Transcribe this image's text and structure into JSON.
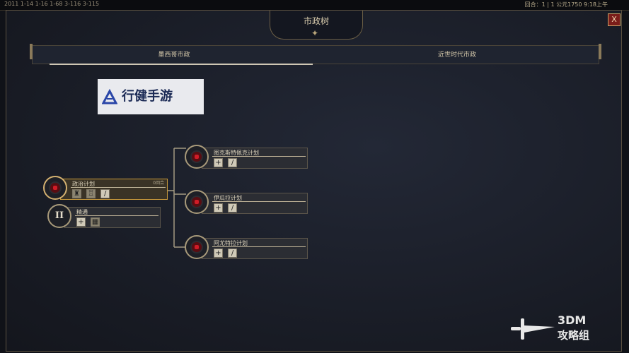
{
  "topbar": {
    "left_text": "2011 1-14 1-16 1-68 3-116 3-115",
    "right_text": "回合：1 | 1  公元1750    9:18上午"
  },
  "window": {
    "title": "市政树",
    "close_label": "X"
  },
  "tabs": [
    {
      "label": "墨西哥市政",
      "active": true
    },
    {
      "label": "近世时代市政",
      "active": false
    }
  ],
  "watermark": {
    "text": "行健手游"
  },
  "tree": {
    "root": {
      "label": "政治计划",
      "count": "0回合"
    },
    "second": {
      "roman": "II",
      "label": "精通"
    },
    "branches": [
      {
        "label": "图克斯特佩克计划"
      },
      {
        "label": "伊瓜拉计划"
      },
      {
        "label": "阿尤特拉计划"
      }
    ]
  },
  "logo": {
    "line1": "3DM",
    "line2": "攻略组"
  },
  "colors": {
    "accent_gold": "#c99a3b",
    "close_red": "#7a1d1a",
    "node_red": "#d01c27",
    "panel_bg": "#2b2d33"
  }
}
